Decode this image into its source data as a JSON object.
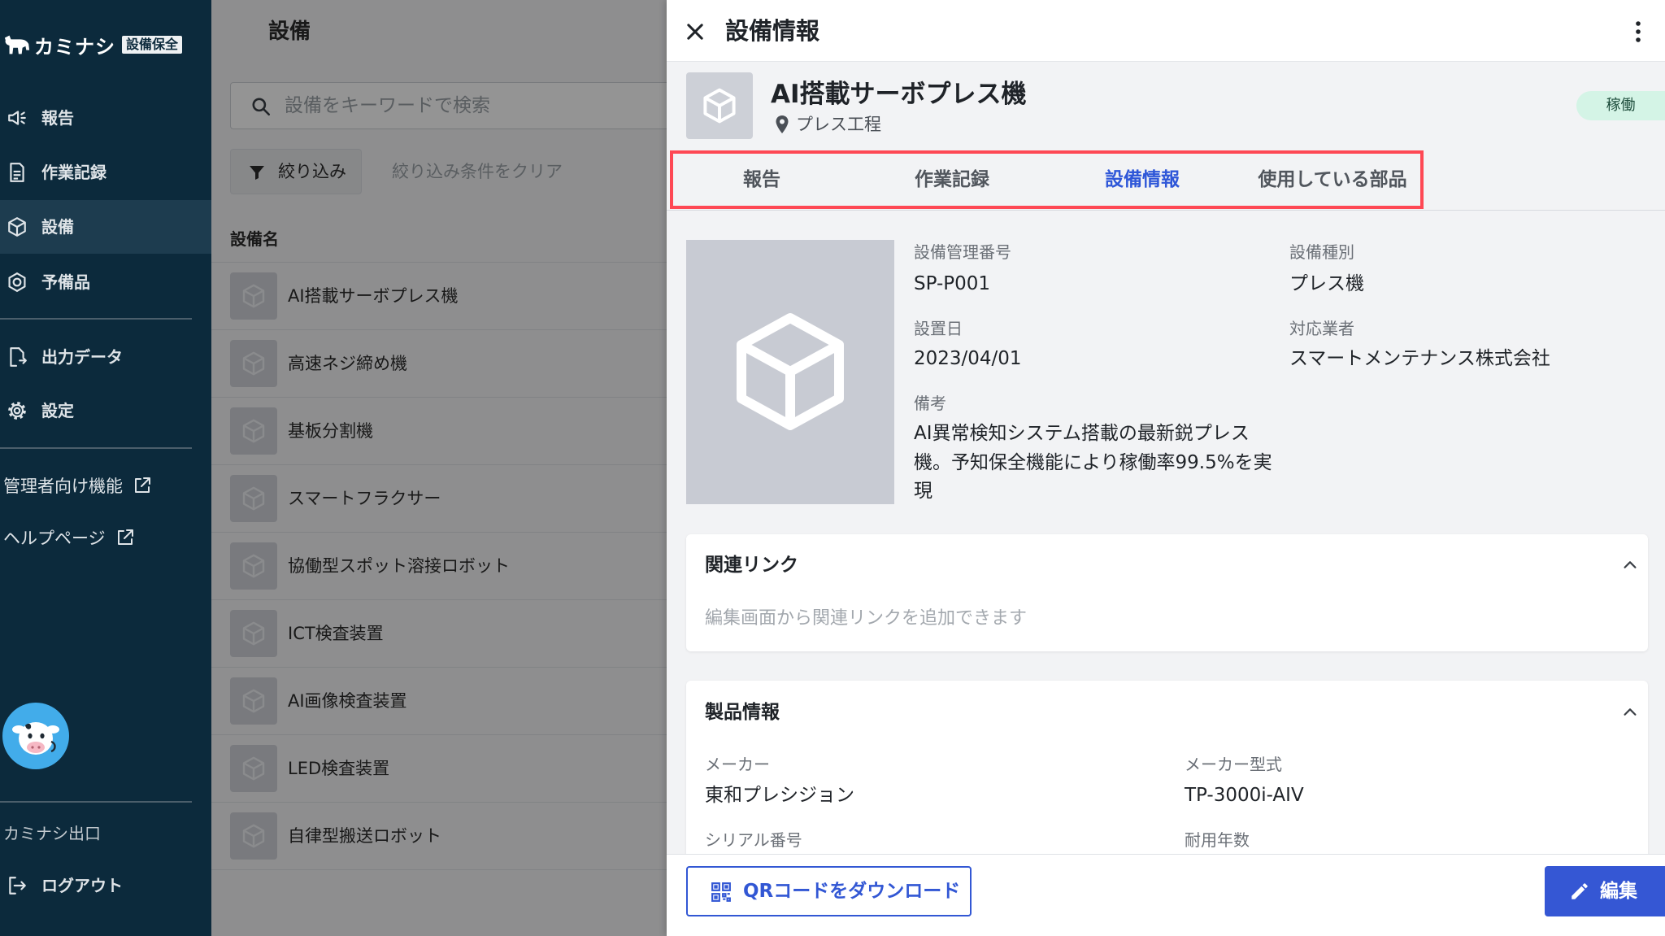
{
  "app": {
    "logo_text": "カミナシ",
    "logo_badge": "設備保全",
    "logo_icon": "cow-logo-icon"
  },
  "sidebar": {
    "nav": [
      {
        "label": "報告",
        "icon": "megaphone-icon"
      },
      {
        "label": "作業記録",
        "icon": "document-icon"
      },
      {
        "label": "設備",
        "icon": "cube-icon",
        "active": true
      },
      {
        "label": "予備品",
        "icon": "nut-icon"
      }
    ],
    "nav2": [
      {
        "label": "出力データ",
        "icon": "file-export-icon"
      },
      {
        "label": "設定",
        "icon": "gear-icon"
      }
    ],
    "links": [
      {
        "label": "管理者向け機能",
        "icon": "external-link-icon"
      },
      {
        "label": "ヘルプページ",
        "icon": "external-link-icon"
      }
    ],
    "chat_avatar_icon": "cow-mascot-icon",
    "exit_label": "カミナシ出口",
    "logout": {
      "label": "ログアウト",
      "icon": "logout-icon"
    }
  },
  "list": {
    "title": "設備",
    "search_placeholder": "設備をキーワードで検索",
    "filter_label": "絞り込み",
    "clear_filter_label": "絞り込み条件をクリア",
    "column_header": "設備名",
    "rows": [
      "AI搭載サーボプレス機",
      "高速ネジ締め機",
      "基板分割機",
      "スマートフラクサー",
      "協働型スポット溶接ロボット",
      "ICT検査装置",
      "AI画像検査装置",
      "LED検査装置",
      "自律型搬送ロボット"
    ]
  },
  "panel": {
    "title": "設備情報",
    "equipment": {
      "name": "AI搭載サーボプレス機",
      "location": "プレス工程",
      "status": "稼働"
    },
    "tabs": [
      {
        "label": "報告"
      },
      {
        "label": "作業記録"
      },
      {
        "label": "設備情報",
        "active": true
      },
      {
        "label": "使用している部品"
      }
    ],
    "details": {
      "management_number": {
        "label": "設備管理番号",
        "value": "SP-P001"
      },
      "equipment_type": {
        "label": "設備種別",
        "value": "プレス機"
      },
      "install_date": {
        "label": "設置日",
        "value": "2023/04/01"
      },
      "vendor": {
        "label": "対応業者",
        "value": "スマートメンテナンス株式会社"
      },
      "notes": {
        "label": "備考",
        "value": "AI異常検知システム搭載の最新鋭プレス機。予知保全機能により稼働率99.5%を実現"
      }
    },
    "related_links": {
      "title": "関連リンク",
      "empty_hint": "編集画面から関連リンクを追加できます",
      "expanded": true
    },
    "product_info": {
      "title": "製品情報",
      "expanded": true,
      "fields": [
        {
          "label": "メーカー",
          "value": "東和プレシジョン"
        },
        {
          "label": "メーカー型式",
          "value": "TP-3000i-AIV"
        },
        {
          "label": "シリアル番号"
        },
        {
          "label": "耐用年数"
        }
      ]
    },
    "footer": {
      "qr_download_label": "QRコードをダウンロード",
      "edit_label": "編集"
    }
  },
  "colors": {
    "sidebar_bg": "#0c2a3c",
    "accent": "#3257d4",
    "status_badge_bg": "#d4f4e6",
    "highlight_border": "#fe4854"
  }
}
